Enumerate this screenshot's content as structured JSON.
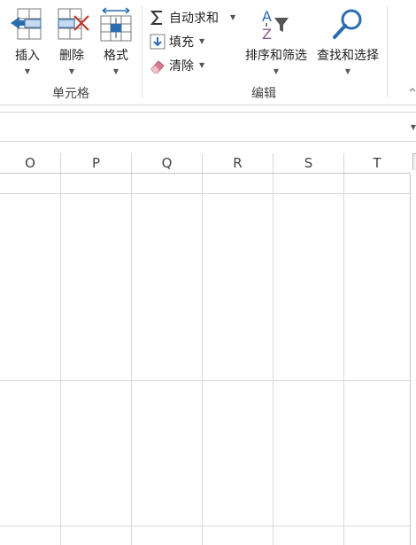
{
  "ribbon": {
    "cells_group": {
      "label": "单元格",
      "insert_label": "插入",
      "delete_label": "删除",
      "format_label": "格式"
    },
    "editing_group": {
      "label": "编辑",
      "autosum_label": "自动求和",
      "fill_label": "填充",
      "clear_label": "清除",
      "sort_filter_label": "排序和筛选",
      "find_select_label": "查找和选择"
    },
    "icons": {
      "insert": "insert-cells-icon",
      "delete": "delete-cells-icon",
      "format": "format-cells-icon",
      "autosum": "sigma-icon",
      "fill": "fill-down-icon",
      "clear": "eraser-icon",
      "sort_filter": "sort-filter-icon",
      "find_select": "magnifier-icon"
    },
    "colors": {
      "accent_blue": "#2b6cb0",
      "delete_red": "#c0392b",
      "eraser_pink": "#d97a8a"
    }
  },
  "sheet": {
    "columns": [
      "O",
      "P",
      "Q",
      "R",
      "S",
      "T"
    ]
  }
}
